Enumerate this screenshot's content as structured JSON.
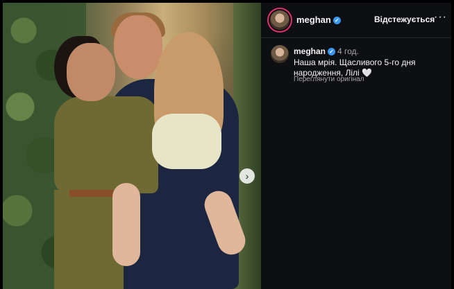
{
  "post": {
    "username": "meghan",
    "verified_badge": "✓",
    "follow_label": "Відстежується",
    "more_icon": "more-horizontal-icon",
    "next_icon": "chevron-right-icon"
  },
  "caption": {
    "username": "meghan",
    "time": "4 год.",
    "text": "Наша мрія. Щасливого 5-го дня народження, Лілі 🤍",
    "translate_label": "Переглянути оригінал"
  },
  "colors": {
    "verified": "#3897f0",
    "panel_bg": "#0e0f12",
    "text": "#f5f5f5",
    "muted": "#a8a8a8"
  }
}
